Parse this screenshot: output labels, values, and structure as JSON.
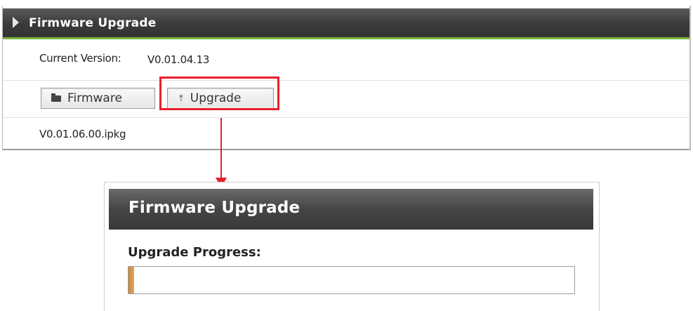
{
  "top_panel": {
    "title": "Firmware Upgrade",
    "current_version_label": "Current Version:",
    "current_version_value": "V0.01.04.13",
    "firmware_button_label": "Firmware",
    "upgrade_button_label": "Upgrade",
    "selected_file": "V0.01.06.00.ipkg"
  },
  "bottom_panel": {
    "title": "Firmware Upgrade",
    "progress_label": "Upgrade Progress:",
    "progress_fraction": 0.012
  },
  "colors": {
    "header_accent": "#77b638",
    "highlight": "#e8202a",
    "progress_fill": "#d49a4c"
  },
  "icons": {
    "header_arrow": "triangle-right-icon",
    "firmware_button": "folder-open-icon",
    "upgrade_button": "upload-icon"
  }
}
